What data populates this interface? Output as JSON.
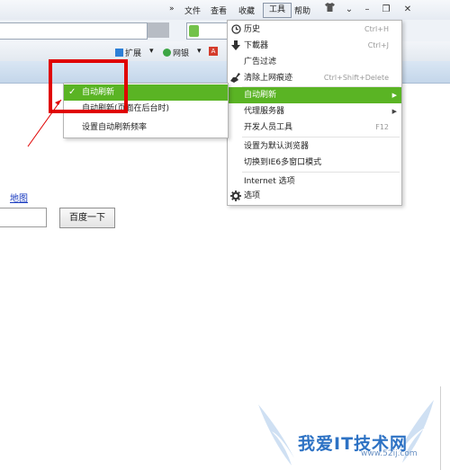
{
  "menubar": {
    "chevron": "»",
    "items": [
      "文件",
      "查看",
      "收藏",
      "工具",
      "帮助"
    ],
    "shirt_icon": "shirt-icon",
    "controls": [
      "⌄",
      "–",
      "❐",
      "✕"
    ]
  },
  "toolbar": {
    "extensions_label": "扩展",
    "netbank_label": "网银",
    "dropdown_glyph": "▾"
  },
  "tools_menu": {
    "items": [
      {
        "label": "历史",
        "shortcut": "Ctrl+H",
        "icon": "clock-icon"
      },
      {
        "label": "下載器",
        "shortcut": "Ctrl+J",
        "icon": "download-arrow-icon"
      },
      {
        "label": "广告过滤",
        "shortcut": ""
      },
      {
        "label": "清除上网痕迹",
        "shortcut": "Ctrl+Shift+Delete",
        "icon": "broom-icon"
      },
      {
        "label": "自动刷新",
        "shortcut": "",
        "submenu_arrow": "▶",
        "highlighted": true
      },
      {
        "label": "代理服务器",
        "shortcut": "",
        "submenu_arrow": "▶"
      },
      {
        "label": "开发人员工具",
        "shortcut": "F12"
      },
      {
        "label": "设置为默认浏览器",
        "shortcut": ""
      },
      {
        "label": "切换到IE6多窗口模式",
        "shortcut": ""
      },
      {
        "label": "Internet 选项",
        "shortcut": ""
      },
      {
        "label": "选项",
        "shortcut": "",
        "icon": "gear-icon"
      }
    ]
  },
  "auto_refresh_submenu": {
    "items": [
      {
        "label": "自动刷新",
        "checked": true,
        "check_glyph": "✓"
      },
      {
        "label": "自动刷新(页面在后台时)"
      },
      {
        "label": "设置自动刷新频率"
      }
    ]
  },
  "page": {
    "map_link": "地图",
    "search_button": "百度一下"
  },
  "watermark": {
    "text": "我爱IT技术网",
    "url": "www.52ij.com"
  },
  "colors": {
    "highlight": "#5ab424",
    "annotation": "#e00000",
    "link": "#1a3bbf",
    "watermark": "#2d72c4"
  }
}
